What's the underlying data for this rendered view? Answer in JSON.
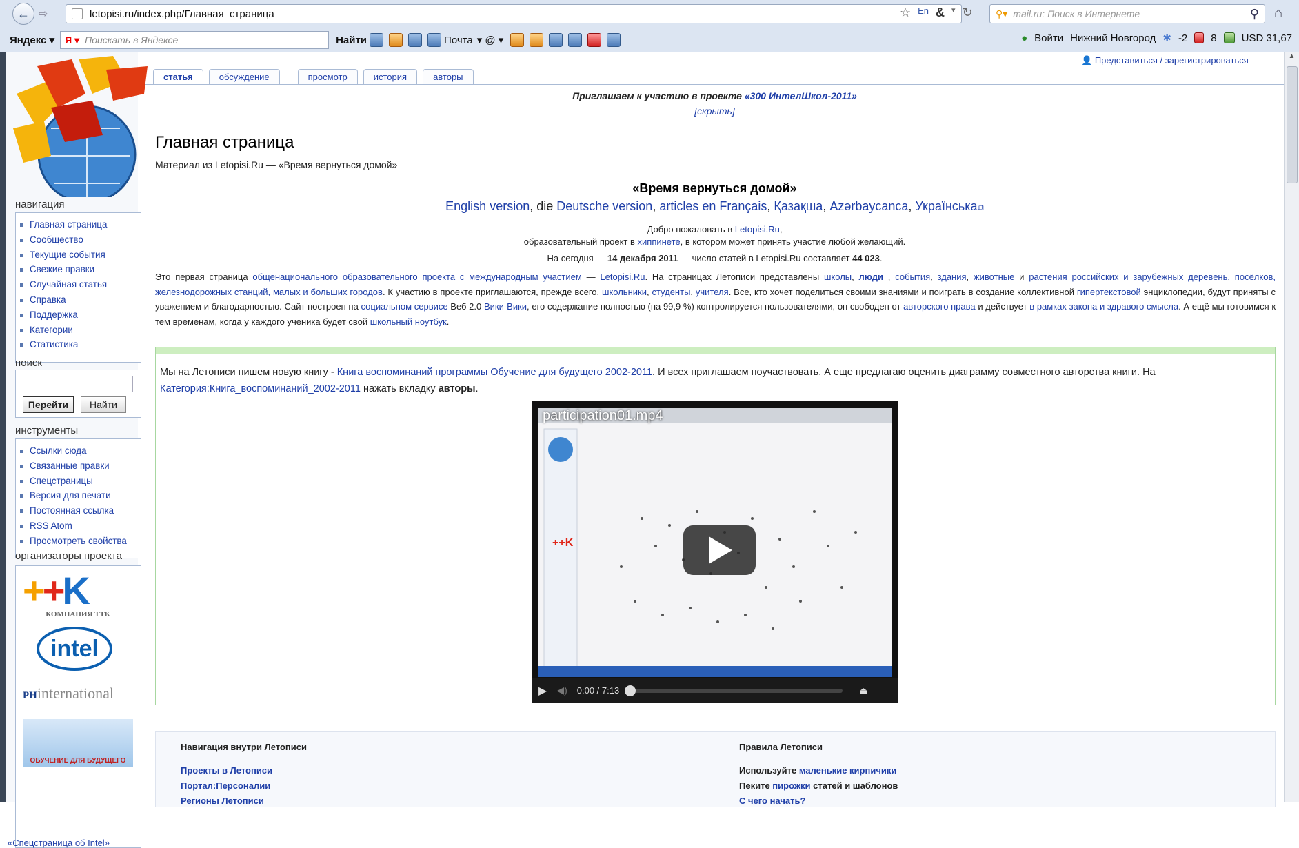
{
  "browser": {
    "url": "letopisi.ru/index.php/Главная_страница",
    "search_placeholder": "mail.ru: Поиск в Интернете",
    "yandex_label": "Яндекс",
    "yandex_placeholder": "Поискать в Яндексе",
    "find_label": "Найти",
    "mail_label": "Почта",
    "login_label": "Войти",
    "city": "Нижний Новгород",
    "temp": "-2",
    "traffic": "8",
    "usd": "USD 31,67"
  },
  "wiki": {
    "login": "Представиться / зарегистрироваться",
    "tabs": [
      "статья",
      "обсуждение",
      "просмотр",
      "история",
      "авторы"
    ],
    "sitenotice_text": "Приглашаем к участию в проекте ",
    "sitenotice_link": "«300 ИнтелШкол-2011»",
    "hide": "[скрыть]",
    "title": "Главная страница",
    "subtitle": "Материал из Letopisi.Ru — «Время вернуться домой»",
    "motto": "«Время вернуться домой»",
    "langs": [
      "English version",
      "Deutsche version",
      "articles en Français",
      "Қазақша",
      "Azərbaycanca",
      "Українська"
    ],
    "langs_sep1": ", die ",
    "welcome_pre": "Добро пожаловать в ",
    "welcome_link": "Letopisi.Ru",
    "welcome2_pre": "образовательный проект в ",
    "welcome2_link": "хиппинете",
    "welcome2_post": ", в котором может принять участие любой желающий.",
    "today_pre": "На сегодня — ",
    "today_date": "14 декабря 2011",
    "today_mid": " — число статей в Letopisi.Ru составляет ",
    "today_count": "44 023",
    "paragraph": {
      "p1": "Это первая страница ",
      "l1": "общенационального образовательного проекта с международным участием",
      "p2": " — ",
      "l2": "Letopisi.Ru",
      "p3": ". На страницах Летописи представлены ",
      "l3": "школы",
      "p4": ", ",
      "l4": "люди",
      "p5": " , ",
      "l5": "события",
      "l6": "здания",
      "l7": "животные",
      "p6": " и ",
      "l8": "растения российских и зарубежных деревень, посёлков, железнодорожных станций, малых и больших городов",
      "p7": ". К участию в проекте приглашаются, прежде всего, ",
      "l9": "школьники",
      "l10": "студенты",
      "l11": "учителя",
      "p8": ". Все, кто хочет поделиться своими знаниями и поиграть в создание коллективной ",
      "l12": "гипертекстовой",
      "p9": " энциклопедии, будут приняты с уважением и благодарностью. Сайт построен на ",
      "l13": "социальном сервисе",
      "p10": " Веб 2.0 ",
      "l14": "Вики-Вики",
      "p11": ", его содержание полностью (на 99,9 %) контролируется пользователями, он свободен от ",
      "l15": "авторского права",
      "p12": " и действует ",
      "l16": "в рамках закона и здравого смысла",
      "p13": ". А ещё мы готовимся к тем временам, когда у каждого ученика будет свой ",
      "l17": "школьный ноутбук",
      "p14": "."
    },
    "book": {
      "t1": "Мы на Летописи пишем новую книгу - ",
      "l1": "Книга воспоминаний программы Обучение для будущего 2002-2011",
      "t2": ". И всех приглашаем поучаствовать. А еще предлагаю оценить диаграмму совместного авторства книги. На ",
      "l2": "Категория:Книга_воспоминаний_2002-2011",
      "t3": " нажать вкладку ",
      "b": "авторы",
      "t4": "."
    },
    "video": {
      "title": "participation01.mp4",
      "time": "0:00 / 7:13"
    },
    "sidebar": {
      "nav_title": "навигация",
      "nav": [
        "Главная страница",
        "Сообщество",
        "Текущие события",
        "Свежие правки",
        "Случайная статья",
        "Справка",
        "Поддержка",
        "Категории",
        "Статистика"
      ],
      "search_title": "поиск",
      "go": "Перейти",
      "search": "Найти",
      "tools_title": "инструменты",
      "tools": [
        "Ссылки сюда",
        "Связанные правки",
        "Спецстраницы",
        "Версия для печати",
        "Постоянная ссылка",
        "RSS Atom",
        "Просмотреть свойства"
      ],
      "org_title": "организаторы проекта",
      "ttk_sub": "КОМПАНИЯ ТТК",
      "intel": "intel",
      "ph": "PH",
      "ph2": "international",
      "future": "ОБУЧЕНИЕ ДЛЯ БУДУЩЕГО",
      "special": "«Спецстраница об Intel»"
    },
    "bottom": {
      "left_title": "Навигация внутри Летописи",
      "left": [
        "Проекты в Летописи",
        "Портал:Персоналии",
        "Регионы Летописи"
      ],
      "right_title": "Правила Летописи",
      "r1_pre": "Используйте ",
      "r1_link": "маленькие кирпичики",
      "r2_pre": "Пеките ",
      "r2_link": "пирожки",
      "r2_post": " статей и шаблонов",
      "r3_link": "С чего начать?"
    }
  },
  "colors": {
    "link": "#1f3fa8",
    "border": "#aabbd5",
    "green": "#cdeec0"
  }
}
